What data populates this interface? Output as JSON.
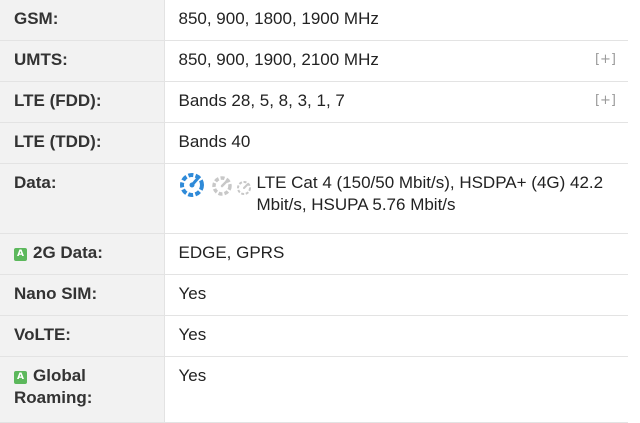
{
  "rows": [
    {
      "label": "GSM:",
      "value": "850, 900, 1800, 1900 MHz",
      "expand": ""
    },
    {
      "label": "UMTS:",
      "value": "850, 900, 1900, 2100 MHz",
      "expand": "[+]"
    },
    {
      "label": "LTE (FDD):",
      "value": "Bands 28, 5, 8, 3, 1, 7",
      "expand": "[+]"
    },
    {
      "label": "LTE (TDD):",
      "value": "Bands 40",
      "expand": ""
    },
    {
      "label": "Data:",
      "value": "LTE Cat 4 (150/50 Mbit/s), HSDPA+ (4G) 42.2 Mbit/s, HSUPA 5.76 Mbit/s",
      "expand": ""
    },
    {
      "label": "2G Data:",
      "value": "EDGE, GPRS",
      "badge": "A"
    },
    {
      "label": "Nano SIM:",
      "value": "Yes"
    },
    {
      "label": "VoLTE:",
      "value": "Yes"
    },
    {
      "label": "Global Roaming:",
      "value": "Yes",
      "badge": "A"
    }
  ],
  "speed_icons": {
    "colors": {
      "active": "#2f8ad8",
      "inactive": "#c8c8c8"
    },
    "icons": [
      "speed-high-icon",
      "speed-medium-icon",
      "speed-low-icon"
    ]
  },
  "colors": {
    "label_bg": "#f2f2f2",
    "border": "#e3e3e3",
    "badge_green": "#5cb85c",
    "expand_gray": "#9a9a9a"
  }
}
